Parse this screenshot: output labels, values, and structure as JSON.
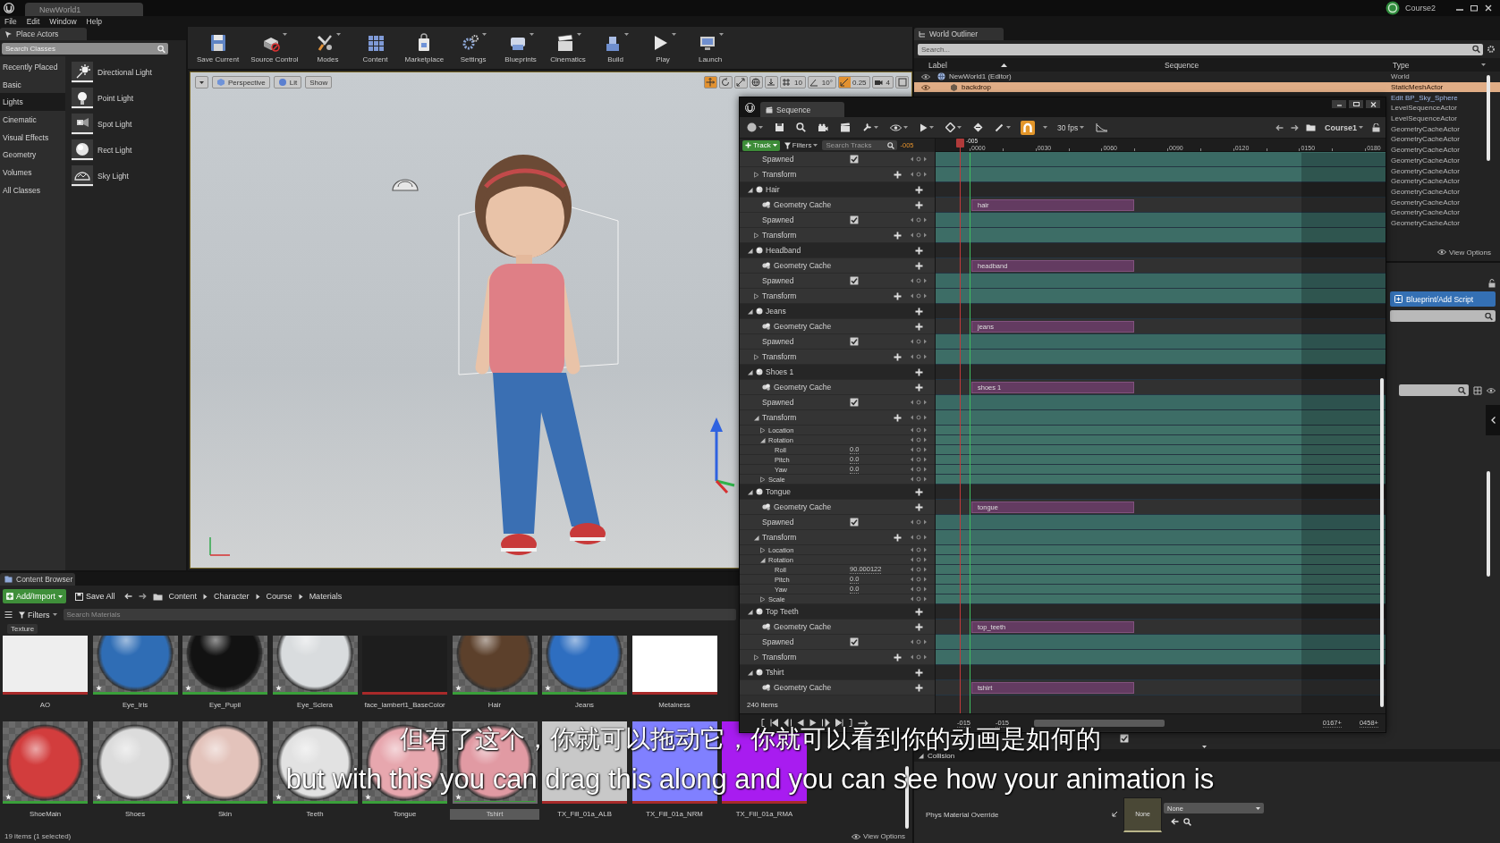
{
  "editor": {
    "tab": "NewWorld1",
    "project": "Course2",
    "menu": [
      "File",
      "Edit",
      "Window",
      "Help"
    ]
  },
  "place_actors": {
    "title": "Place Actors",
    "search": {
      "placeholder": "Search Classes"
    },
    "categories": [
      {
        "label": "Recently Placed",
        "selected": false
      },
      {
        "label": "Basic",
        "selected": false
      },
      {
        "label": "Lights",
        "selected": true
      },
      {
        "label": "Cinematic",
        "selected": false
      },
      {
        "label": "Visual Effects",
        "selected": false
      },
      {
        "label": "Geometry",
        "selected": false
      },
      {
        "label": "Volumes",
        "selected": false
      },
      {
        "label": "All Classes",
        "selected": false
      }
    ],
    "items": [
      {
        "label": "Directional Light",
        "kind": "directional"
      },
      {
        "label": "Point Light",
        "kind": "point"
      },
      {
        "label": "Spot Light",
        "kind": "spot"
      },
      {
        "label": "Rect Light",
        "kind": "rect"
      },
      {
        "label": "Sky Light",
        "kind": "sky"
      }
    ]
  },
  "toolbar": [
    {
      "label": "Save Current",
      "kind": "save",
      "dropdown": false
    },
    {
      "label": "Source Control",
      "kind": "source",
      "dropdown": true
    },
    {
      "label": "Modes",
      "kind": "modes",
      "dropdown": true
    },
    {
      "label": "Content",
      "kind": "content",
      "dropdown": false
    },
    {
      "label": "Marketplace",
      "kind": "market",
      "dropdown": false
    },
    {
      "label": "Settings",
      "kind": "settings",
      "dropdown": true
    },
    {
      "label": "Blueprints",
      "kind": "blueprints",
      "dropdown": true
    },
    {
      "label": "Cinematics",
      "kind": "cinematics",
      "dropdown": true
    },
    {
      "label": "Build",
      "kind": "build",
      "dropdown": true
    },
    {
      "label": "Play",
      "kind": "play",
      "dropdown": true
    },
    {
      "label": "Launch",
      "kind": "launch",
      "dropdown": true
    }
  ],
  "viewport": {
    "view_buttons": [
      {
        "label": "Perspective",
        "kind": "perspective"
      },
      {
        "label": "Lit",
        "kind": "lit"
      },
      {
        "label": "Show",
        "kind": "plain"
      }
    ],
    "transform_tools": [
      {
        "kind": "translate",
        "selected": true
      },
      {
        "kind": "rotate",
        "selected": false
      },
      {
        "kind": "scale",
        "selected": false
      }
    ],
    "snaps": [
      {
        "kind": "grid",
        "label": "10",
        "on": false
      },
      {
        "kind": "rotation",
        "label": "10°",
        "on": false
      },
      {
        "kind": "scale",
        "label": "0.25",
        "on": true
      },
      {
        "kind": "camera",
        "label": "4",
        "on": false
      }
    ]
  },
  "content_browser": {
    "title": "Content Browser",
    "add_button": "Add/Import",
    "save_all": "Save All",
    "path": [
      "Content",
      "Character",
      "Course",
      "Materials"
    ],
    "filters": "Filters",
    "search": {
      "placeholder": "Search Materials"
    },
    "filter_tag": "Texture",
    "rows": [
      [
        {
          "label": "AO",
          "kind": "texture",
          "color": "#eeeeee",
          "selected": false
        },
        {
          "label": "Eye_Iris",
          "kind": "material",
          "color": "#2f6db5",
          "selected": false
        },
        {
          "label": "Eye_Pupil",
          "kind": "material",
          "color": "#121212",
          "selected": false
        },
        {
          "label": "Eye_Sclera",
          "kind": "material",
          "color": "#d9dcde",
          "selected": false
        },
        {
          "label": "face_lambert1_BaseColor",
          "kind": "texture",
          "color": "#1d1d1d",
          "selected": false
        },
        {
          "label": "Hair",
          "kind": "material",
          "color": "#5c402b",
          "selected": false
        },
        {
          "label": "Jeans",
          "kind": "material",
          "color": "#2e6ec0",
          "selected": false
        },
        {
          "label": "Metalness",
          "kind": "texture",
          "color": "#ffffff",
          "selected": false
        }
      ],
      [
        {
          "label": "ShoeMain",
          "kind": "material",
          "color": "#d23d3d",
          "selected": false
        },
        {
          "label": "Shoes",
          "kind": "material",
          "color": "#dcdcdc",
          "selected": false
        },
        {
          "label": "Skin",
          "kind": "material",
          "color": "#e3c3bb",
          "selected": false
        },
        {
          "label": "Teeth",
          "kind": "material",
          "color": "#e2e2e2",
          "selected": false
        },
        {
          "label": "Tongue",
          "kind": "material",
          "color": "#e7a7ae",
          "selected": false
        },
        {
          "label": "Tshirt",
          "kind": "material",
          "color": "#e19aa3",
          "selected": true
        },
        {
          "label": "TX_Fill_01a_ALB",
          "kind": "texture",
          "color": "#c8c8c8",
          "selected": false
        },
        {
          "label": "TX_Fill_01a_NRM",
          "kind": "texture",
          "color": "#8080ff",
          "selected": false
        },
        {
          "label": "TX_Fill_01a_RMA",
          "kind": "texture",
          "color": "#a81cf0",
          "selected": false
        }
      ]
    ],
    "status": "19 items (1 selected)",
    "view_options": "View Options"
  },
  "sequencer": {
    "title": "Sequence",
    "frame_rate": "30 fps",
    "sequence_name": "Course1",
    "snapping": true,
    "add_track": "Track",
    "filters": "Filters",
    "search": {
      "placeholder": "Search Tracks"
    },
    "current_time": "-005",
    "playhead_label": "-005",
    "ruler": [
      "0000",
      "0030",
      "0060",
      "0090",
      "0120",
      "0150",
      "0180"
    ],
    "tracks": [
      {
        "kind": "tail",
        "children": [
          {
            "kind": "spawned",
            "label": "Spawned",
            "checked": true
          },
          {
            "kind": "transform",
            "label": "Transform",
            "expanded": false
          }
        ]
      },
      {
        "kind": "actor",
        "label": "Hair",
        "expanded": true,
        "children": [
          {
            "kind": "cache",
            "label": "Geometry Cache",
            "section": "hair"
          },
          {
            "kind": "spawned",
            "label": "Spawned",
            "checked": true
          },
          {
            "kind": "transform",
            "label": "Transform",
            "expanded": false
          }
        ]
      },
      {
        "kind": "actor",
        "label": "Headband",
        "expanded": true,
        "children": [
          {
            "kind": "cache",
            "label": "Geometry Cache",
            "section": "headband"
          },
          {
            "kind": "spawned",
            "label": "Spawned",
            "checked": true
          },
          {
            "kind": "transform",
            "label": "Transform",
            "expanded": false
          }
        ]
      },
      {
        "kind": "actor",
        "label": "Jeans",
        "expanded": true,
        "children": [
          {
            "kind": "cache",
            "label": "Geometry Cache",
            "section": "jeans"
          },
          {
            "kind": "spawned",
            "label": "Spawned",
            "checked": true
          },
          {
            "kind": "transform",
            "label": "Transform",
            "expanded": false
          }
        ]
      },
      {
        "kind": "actor",
        "label": "Shoes 1",
        "expanded": true,
        "children": [
          {
            "kind": "cache",
            "label": "Geometry Cache",
            "section": "shoes 1"
          },
          {
            "kind": "spawned",
            "label": "Spawned",
            "checked": true
          },
          {
            "kind": "transform",
            "label": "Transform",
            "expanded": true,
            "children": [
              {
                "kind": "channel",
                "label": "Location",
                "expanded": false
              },
              {
                "kind": "channel",
                "label": "Rotation",
                "expanded": true,
                "children": [
                  {
                    "kind": "value",
                    "label": "Roll",
                    "value": "0.0"
                  },
                  {
                    "kind": "value",
                    "label": "Pitch",
                    "value": "0.0"
                  },
                  {
                    "kind": "value",
                    "label": "Yaw",
                    "value": "0.0"
                  }
                ]
              },
              {
                "kind": "channel",
                "label": "Scale",
                "expanded": false
              }
            ]
          }
        ]
      },
      {
        "kind": "actor",
        "label": "Tongue",
        "expanded": true,
        "children": [
          {
            "kind": "cache",
            "label": "Geometry Cache",
            "section": "tongue"
          },
          {
            "kind": "spawned",
            "label": "Spawned",
            "checked": true
          },
          {
            "kind": "transform",
            "label": "Transform",
            "expanded": true,
            "children": [
              {
                "kind": "channel",
                "label": "Location",
                "expanded": false
              },
              {
                "kind": "channel",
                "label": "Rotation",
                "expanded": true,
                "children": [
                  {
                    "kind": "value",
                    "label": "Roll",
                    "value": "90.000122"
                  },
                  {
                    "kind": "value",
                    "label": "Pitch",
                    "value": "0.0"
                  },
                  {
                    "kind": "value",
                    "label": "Yaw",
                    "value": "0.0"
                  }
                ]
              },
              {
                "kind": "channel",
                "label": "Scale",
                "expanded": false
              }
            ]
          }
        ]
      },
      {
        "kind": "actor",
        "label": "Top Teeth",
        "expanded": true,
        "children": [
          {
            "kind": "cache",
            "label": "Geometry Cache",
            "section": "top_teeth"
          },
          {
            "kind": "spawned",
            "label": "Spawned",
            "checked": true
          },
          {
            "kind": "transform",
            "label": "Transform",
            "expanded": false
          }
        ]
      },
      {
        "kind": "actor",
        "label": "Tshirt",
        "expanded": true,
        "children": [
          {
            "kind": "cache",
            "label": "Geometry Cache",
            "section": "tshirt"
          }
        ]
      }
    ],
    "item_count": "240 items",
    "range_fields": [
      "-015",
      "-015",
      "0167+",
      "0458+"
    ]
  },
  "outliner": {
    "title": "World Outliner",
    "search": {
      "placeholder": "Search..."
    },
    "columns": [
      "Label",
      "Sequence",
      "Type"
    ],
    "rows": [
      {
        "label": "NewWorld1 (Editor)",
        "type": "World",
        "kind": "world",
        "selected": false
      },
      {
        "label": "backdrop",
        "type": "StaticMeshActor",
        "kind": "mesh",
        "selected": true
      },
      {
        "type": "Edit BP_Sky_Sphere",
        "kind": "link",
        "selected": false
      },
      {
        "type": "LevelSequenceActor",
        "kind": "actor",
        "selected": false
      },
      {
        "type": "LevelSequenceActor",
        "kind": "actor",
        "selected": false
      },
      {
        "type": "GeometryCacheActor",
        "kind": "actor",
        "selected": false
      },
      {
        "type": "GeometryCacheActor",
        "kind": "actor",
        "selected": false
      },
      {
        "type": "GeometryCacheActor",
        "kind": "actor",
        "selected": false
      },
      {
        "type": "GeometryCacheActor",
        "kind": "actor",
        "selected": false
      },
      {
        "type": "GeometryCacheActor",
        "kind": "actor",
        "selected": false
      },
      {
        "type": "GeometryCacheActor",
        "kind": "actor",
        "selected": false
      },
      {
        "type": "GeometryCacheActor",
        "kind": "actor",
        "selected": false
      },
      {
        "type": "GeometryCacheActor",
        "kind": "actor",
        "selected": false
      },
      {
        "type": "GeometryCacheActor",
        "kind": "actor",
        "selected": false
      },
      {
        "type": "GeometryCacheActor",
        "kind": "actor",
        "selected": false
      }
    ],
    "view_options": "View Options"
  },
  "details": {
    "add_script": "Blueprint/Add Script",
    "checkbox": {
      "checked": true
    },
    "collision": {
      "title": "Collision",
      "expanded": true
    },
    "phys_material": {
      "label": "Phys Material Override",
      "thumbnail": "None",
      "value": "None"
    }
  },
  "subtitles": [
    "但有了这个，你就可以拖动它，你就可以看到你的动画是如何的",
    "but with this you can drag this along and you can see how your animation is"
  ]
}
